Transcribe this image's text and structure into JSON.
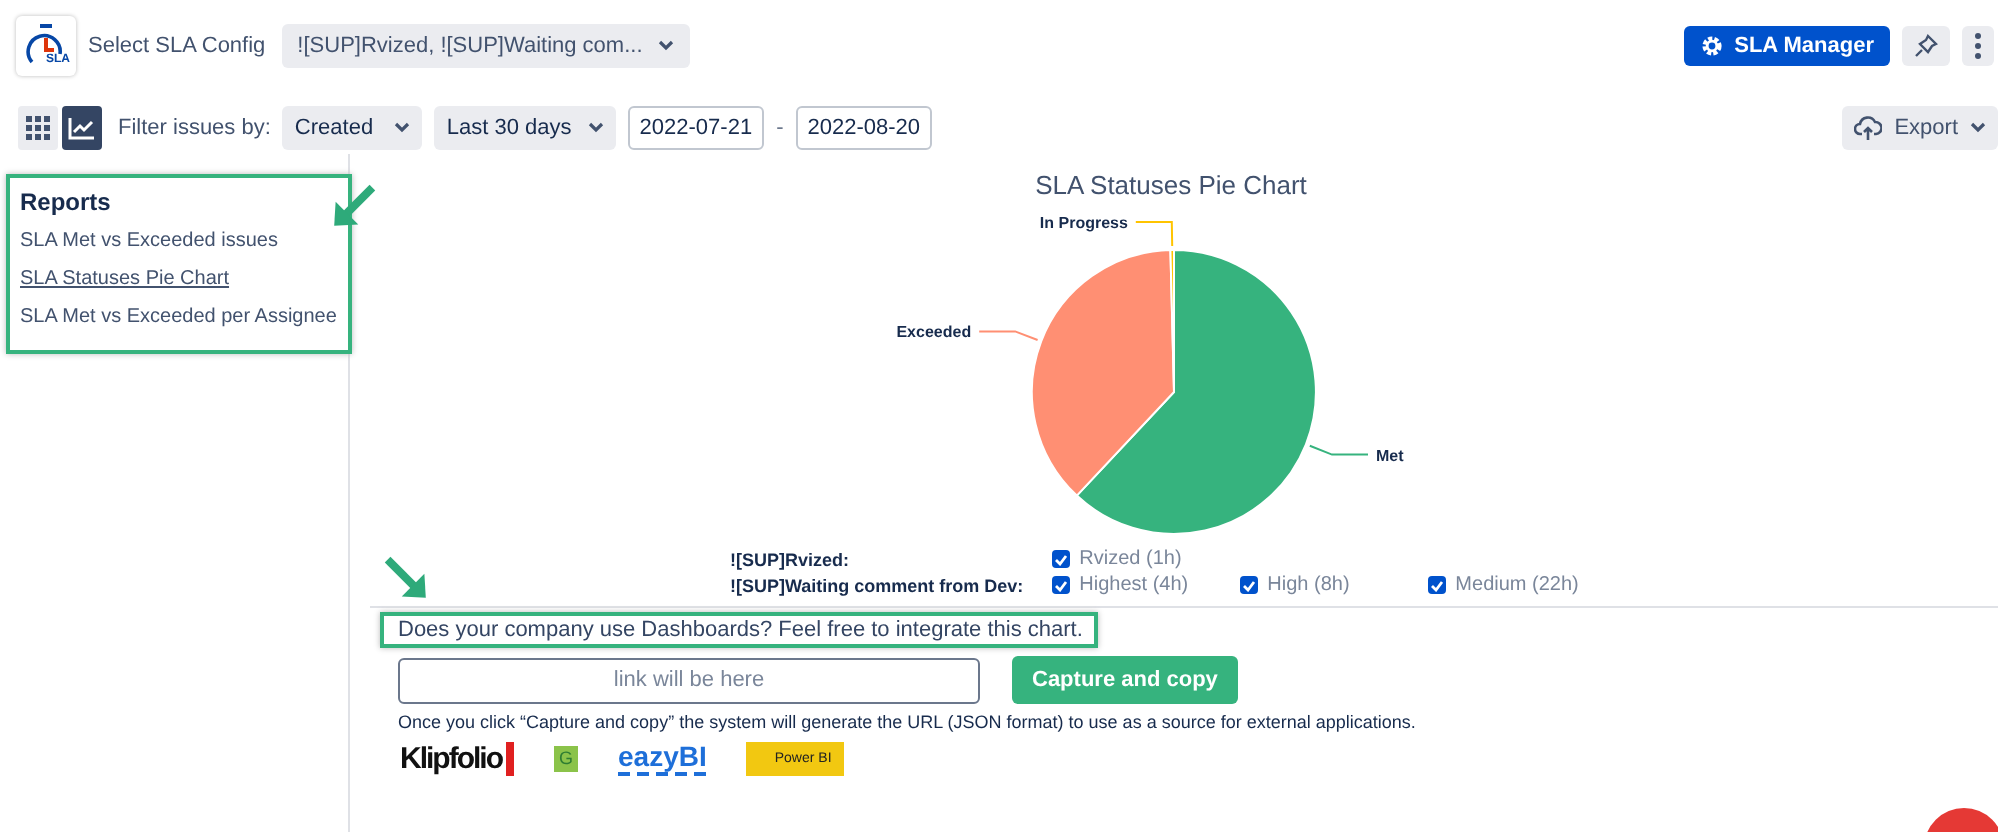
{
  "header": {
    "logo_text": "SLA",
    "config_label": "Select SLA Config",
    "config_value": "![SUP]Rvized, ![SUP]Waiting com...",
    "manager_button": "SLA Manager"
  },
  "toolbar": {
    "views": [
      {
        "kind": "grid",
        "selected": false
      },
      {
        "kind": "chart",
        "selected": true
      }
    ],
    "filter_label": "Filter issues by:",
    "filter_field": "Created",
    "period": "Last 30 days",
    "date_from": "2022-07-21",
    "date_separator": "-",
    "date_to": "2022-08-20",
    "export_button": "Export"
  },
  "sidebar": {
    "highlighted": true,
    "title": "Reports",
    "items": [
      {
        "label": "SLA Met vs Exceeded issues",
        "selected": false
      },
      {
        "label": "SLA Statuses Pie Chart",
        "selected": true
      },
      {
        "label": "SLA Met vs Exceeded per Assignee",
        "selected": false
      }
    ]
  },
  "chart": {
    "chart_data": {
      "type": "pie",
      "title": "SLA Statuses Pie Chart",
      "categories": [
        "Met",
        "Exceeded",
        "In Progress"
      ],
      "values": [
        0.62,
        0.376,
        0.004
      ],
      "colors": [
        "#36b37e",
        "#ff8f73",
        "#ffc400"
      ]
    }
  },
  "legend": [
    {
      "label": "![SUP]Rvized:",
      "options": [
        {
          "label": "Rvized (1h)",
          "checked": true
        }
      ]
    },
    {
      "label": "![SUP]Waiting comment from Dev:",
      "options": [
        {
          "label": "Highest (4h)",
          "checked": true
        },
        {
          "label": "High (8h)",
          "checked": true
        },
        {
          "label": "Medium (22h)",
          "checked": true
        }
      ]
    }
  ],
  "integration": {
    "highlighted": true,
    "prompt": "Does your company use Dashboards? Feel free to integrate this chart.",
    "link_placeholder": "link will be here",
    "capture_button": "Capture and copy",
    "note": "Once you click “Capture and copy” the system will generate the URL (JSON format) to use as a source for external applications.",
    "logos": [
      {
        "kind": "klipfolio",
        "text": "Klipfolio"
      },
      {
        "kind": "square",
        "text": "G"
      },
      {
        "kind": "eazybi",
        "text": "eazyBI"
      },
      {
        "kind": "powerbi",
        "text": "Power BI"
      }
    ]
  }
}
